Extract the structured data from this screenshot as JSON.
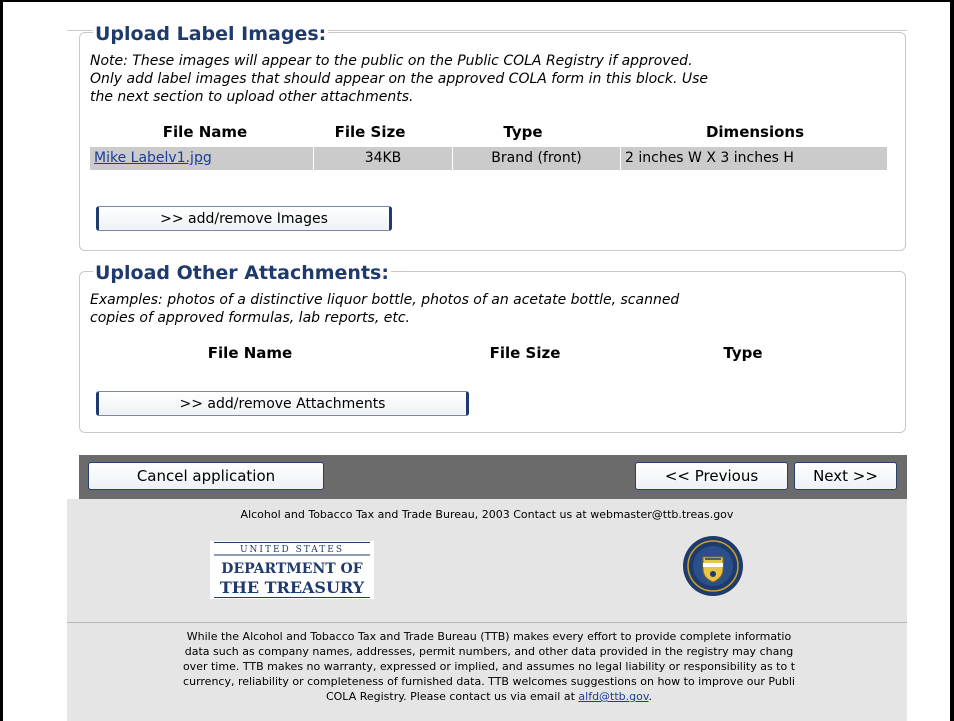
{
  "label_images": {
    "legend": "Upload Label Images:",
    "note_lines": [
      "Note: These images will appear to the public on the Public COLA Registry if approved.",
      "Only add label images that should appear on the approved COLA form in this block. Use",
      "the next section to upload other attachments."
    ],
    "headers": [
      "File Name",
      "File Size",
      "Type",
      "Dimensions"
    ],
    "rows": [
      {
        "file_name": "Mike Labelv1.jpg",
        "file_size": "34KB",
        "type": "Brand (front)",
        "dimensions": "2 inches W X 3 inches H"
      }
    ],
    "button_label": ">> add/remove Images"
  },
  "other_attachments": {
    "legend": "Upload Other Attachments:",
    "note_lines": [
      "Examples: photos of a distinctive liquor bottle, photos of an acetate bottle, scanned",
      "copies of approved formulas, lab reports, etc."
    ],
    "headers": [
      "File Name",
      "File Size",
      "Type"
    ],
    "button_label": ">> add/remove Attachments"
  },
  "nav": {
    "cancel_label": "Cancel application",
    "previous_label": "<< Previous",
    "next_label": "Next >>"
  },
  "footer": {
    "contact": "Alcohol and Tobacco Tax and Trade Bureau, 2003  Contact us at webmaster@ttb.treas.gov",
    "logo_lines": [
      "UNITED STATES",
      "DEPARTMENT OF",
      "THE TREASURY"
    ],
    "disclaimer_lines": [
      "While the Alcohol and Tobacco Tax and Trade Bureau (TTB) makes every effort to provide complete informatio",
      "data such as company names, addresses, permit numbers, and other data provided in the registry may chang",
      "over time. TTB makes no warranty, expressed or implied, and assumes no legal liability or responsibility as to t",
      "currency, reliability or completeness of furnished data. TTB welcomes suggestions on how to improve our Publi"
    ],
    "disclaimer_last_prefix": "COLA Registry. Please contact us via email at ",
    "email_link": "alfd@ttb.gov",
    "disclaimer_last_suffix": "."
  },
  "colors": {
    "legend": "#1f3a6c",
    "link": "#1a3d9c",
    "nav_bar": "#6b6b6b",
    "footer_bg": "#e5e5e5",
    "row_bg": "#cbcbcb"
  }
}
